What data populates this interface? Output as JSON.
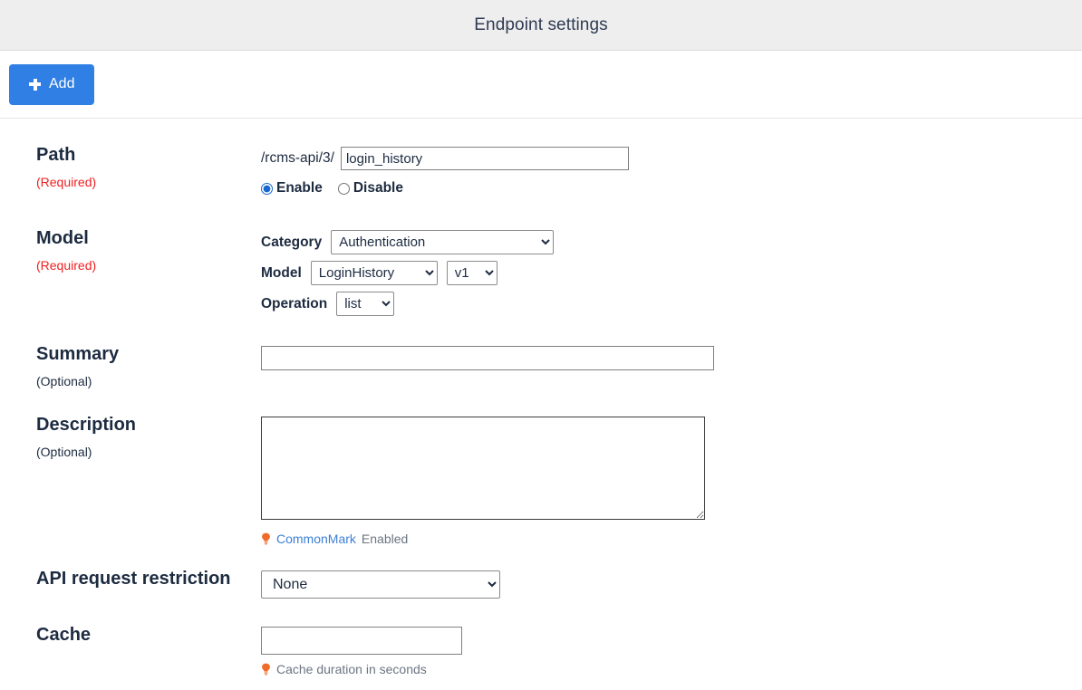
{
  "header": {
    "title": "Endpoint settings"
  },
  "toolbar": {
    "add_label": "Add",
    "add_icon": "plus-icon",
    "accent_color": "#2f7fe4"
  },
  "form": {
    "path": {
      "label": "Path",
      "requirement": "(Required)",
      "prefix": "/rcms-api/3/",
      "value": "login_history",
      "placeholder": "",
      "status_options": [
        {
          "label": "Enable",
          "checked": true
        },
        {
          "label": "Disable",
          "checked": false
        }
      ]
    },
    "model": {
      "label": "Model",
      "requirement": "(Required)",
      "category_label": "Category",
      "category_value": "Authentication",
      "model_label": "Model",
      "model_value": "LoginHistory",
      "version_value": "v1",
      "operation_label": "Operation",
      "operation_value": "list"
    },
    "summary": {
      "label": "Summary",
      "requirement": "(Optional)",
      "value": "",
      "placeholder": ""
    },
    "description": {
      "label": "Description",
      "requirement": "(Optional)",
      "value": "",
      "placeholder": "",
      "hint_icon": "lightbulb-icon",
      "hint_link": "CommonMark",
      "hint_text": "Enabled"
    },
    "restriction": {
      "label": "API request restriction",
      "value": "None"
    },
    "cache": {
      "label": "Cache",
      "value": "",
      "placeholder": "",
      "hint_icon": "lightbulb-icon",
      "hint_text": "Cache duration in seconds"
    }
  },
  "colors": {
    "required": "#f02020",
    "link": "#3d7fd6",
    "bulb": "#f06a28",
    "header_bg": "#eeeeee"
  }
}
